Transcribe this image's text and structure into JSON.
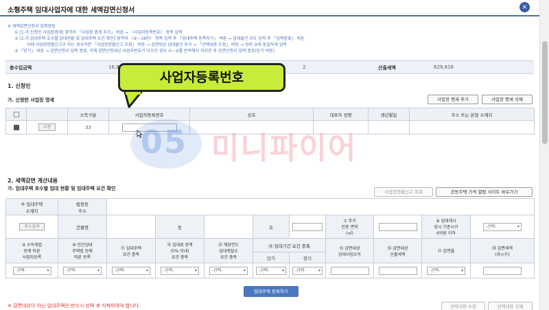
{
  "dialog": {
    "title": "소형주택 임대사업자에 대한 세액감면신청서",
    "close_symbol": "×"
  },
  "guide": {
    "heading": "※ 세액감면신청서 입력방법",
    "lines": [
      "① [1-가.신청인 사업장명세] 영역의 「사업장 명세 추가」 버튼 → 〈사업자등록번호〉 항목 입력",
      "② [2-가.임대주택 호수별 임대현황 및 임대주택 요건 확인] 영역의 〈⑥~18번〉 항목 입력 후 「임대주택 등록하기」 버튼 → 임대물건 모두 입력 후 「입력완료」 버튼",
      "이때 사업장현황신고가 되는 경우이면 「사업장현황신고 조회」 버튼 → 감면대상 임대물건 추가 → 「선택내용 수정」 버튼 → 위의 ②와 동일하게 입력",
      "③ 「닫기」 버튼 → 감면신청서 입력 종료, 이해 감면신청대상 사업자번호가 다수인 경우 ①~②를 반복해서 처리한 후 감면신청서 입력 종료(닫기 버튼)"
    ]
  },
  "summary": {
    "label1": "총수입금액",
    "value1": "16,900,000",
    "value2": "2",
    "label2": "산출세액",
    "value3": "629,616"
  },
  "section1": {
    "title": "1. 신청인",
    "subtitle": "가. 신청한 사업장 명세",
    "btn_add": "사업장 명세 추가",
    "btn_delete": "사업장 명세 삭제",
    "headers": [
      "소득구분",
      "사업자등록번호",
      "상호",
      "대표자 성명",
      "생년월일",
      "주소 또는 본점 소재지"
    ],
    "row": {
      "edit_label": "수정",
      "income_type": "33"
    }
  },
  "callout": {
    "text": "사업자등록번호"
  },
  "watermark": {
    "number": "05",
    "text": "미니파이어"
  },
  "section2": {
    "title": "2. 세액감면 계산내용",
    "subtitle": "가. 임대주택 호수별 임대 현황 및 임대주택 요건 확인",
    "btn_report": "사업장현황신고 조회",
    "btn_price": "공동주택 가격 열람 사이트 바로가기",
    "h_location": "⑥ 임대주택\n소재지",
    "h_address": "법정동\n주소",
    "btn_address": "주소검색",
    "building_label": "건물명",
    "dong_label": "동",
    "ho_label": "호",
    "area_label": "⑦ 주거\n전용 면적\n(㎡)",
    "price_label": "⑧ 임대개시\n당시 기준시가\n6억원 이하",
    "h_reg": "⑨ 소득세법\n등에 따른\n사업자등록",
    "h_private": "⑩ 민간임대\n주택법 등에\n따른 등록",
    "h_req": "⑪ 임대주택\n요건 충족",
    "h_rent": "⑫ 임대료 증액\n(5% 이내)\n요건 충족",
    "h_year": "⑬ 해당연도\n임대계절수\n요건 충족",
    "h_period": "⑭ 임대기간 요건 충족",
    "h_short": "단기",
    "h_long": "장기",
    "h_income": "⑮ 감면대상\n임대사업소득",
    "h_tax": "⑯ 감면대상\n산출세액",
    "h_rate": "⑰ 감면율",
    "h_amount": "⑱ 감면세액\n(⑯×⑰)",
    "select_placeholder": "-선택-",
    "btn_register": "임대주택 등록하기",
    "btn_edit": "선택내용 수정",
    "btn_del": "선택내용 삭제",
    "warning": "※ 감면대상이 아닌 임대주택은 반드시 선택 후 삭제하여야 합니다."
  }
}
